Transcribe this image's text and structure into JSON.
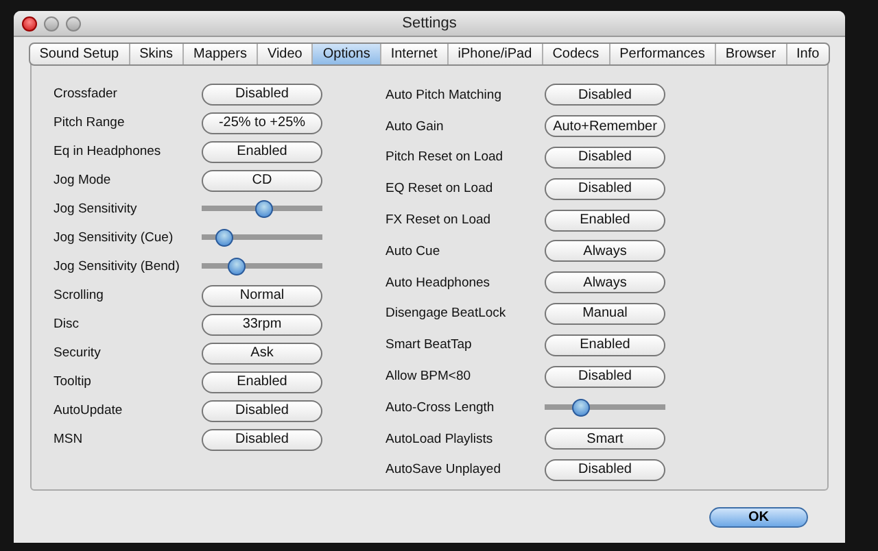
{
  "window": {
    "title": "Settings"
  },
  "tabs": [
    {
      "label": "Sound Setup",
      "selected": false
    },
    {
      "label": "Skins",
      "selected": false
    },
    {
      "label": "Mappers",
      "selected": false
    },
    {
      "label": "Video",
      "selected": false
    },
    {
      "label": "Options",
      "selected": true
    },
    {
      "label": "Internet",
      "selected": false
    },
    {
      "label": "iPhone/iPad",
      "selected": false
    },
    {
      "label": "Codecs",
      "selected": false
    },
    {
      "label": "Performances",
      "selected": false
    },
    {
      "label": "Browser",
      "selected": false
    },
    {
      "label": "Info",
      "selected": false
    }
  ],
  "left_options": [
    {
      "kind": "button",
      "label": "Crossfader",
      "value": "Disabled"
    },
    {
      "kind": "button",
      "label": "Pitch Range",
      "value": "-25% to +25%"
    },
    {
      "kind": "button",
      "label": "Eq in Headphones",
      "value": "Enabled"
    },
    {
      "kind": "button",
      "label": "Jog Mode",
      "value": "CD"
    },
    {
      "kind": "slider",
      "label": "Jog Sensitivity",
      "level": 0.51
    },
    {
      "kind": "slider",
      "label": "Jog Sensitivity (Cue)",
      "level": 0.18
    },
    {
      "kind": "slider",
      "label": "Jog Sensitivity (Bend)",
      "level": 0.28
    },
    {
      "kind": "button",
      "label": "Scrolling",
      "value": "Normal"
    },
    {
      "kind": "button",
      "label": "Disc",
      "value": "33rpm"
    },
    {
      "kind": "button",
      "label": "Security",
      "value": "Ask"
    },
    {
      "kind": "button",
      "label": "Tooltip",
      "value": "Enabled"
    },
    {
      "kind": "button",
      "label": "AutoUpdate",
      "value": "Disabled"
    },
    {
      "kind": "button",
      "label": "MSN",
      "value": "Disabled"
    }
  ],
  "right_options": [
    {
      "kind": "button",
      "label": "Auto Pitch Matching",
      "value": "Disabled"
    },
    {
      "kind": "button",
      "label": "Auto Gain",
      "value": "Auto+Remember"
    },
    {
      "kind": "button",
      "label": "Pitch Reset on Load",
      "value": "Disabled"
    },
    {
      "kind": "button",
      "label": "EQ Reset on Load",
      "value": "Disabled"
    },
    {
      "kind": "button",
      "label": "FX Reset on Load",
      "value": "Enabled"
    },
    {
      "kind": "button",
      "label": "Auto Cue",
      "value": "Always"
    },
    {
      "kind": "button",
      "label": "Auto Headphones",
      "value": "Always"
    },
    {
      "kind": "button",
      "label": "Disengage BeatLock",
      "value": "Manual"
    },
    {
      "kind": "button",
      "label": "Smart BeatTap",
      "value": "Enabled"
    },
    {
      "kind": "button",
      "label": "Allow BPM<80",
      "value": "Disabled"
    },
    {
      "kind": "slider",
      "label": "Auto-Cross Length",
      "level": 0.29
    },
    {
      "kind": "button",
      "label": "AutoLoad Playlists",
      "value": "Smart"
    },
    {
      "kind": "button",
      "label": "AutoSave Unplayed",
      "value": "Disabled"
    }
  ],
  "ok_button": "OK"
}
